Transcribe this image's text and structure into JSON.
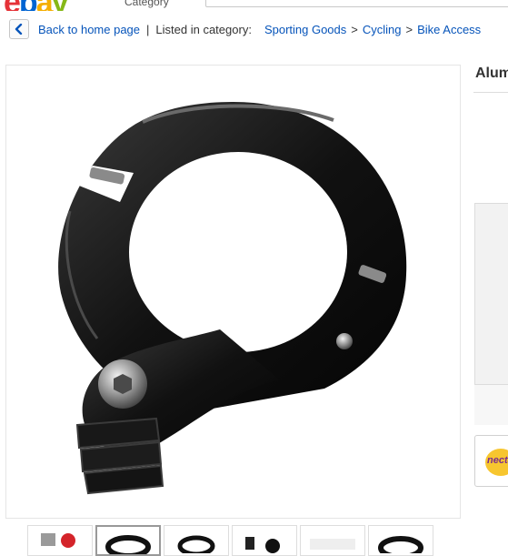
{
  "header": {
    "category_selector": "Category"
  },
  "breadcrumb": {
    "back_link": "Back to home page",
    "separator": "|",
    "listed_label": "Listed in category:",
    "crumbs": [
      "Sporting Goods",
      "Cycling",
      "Bike Access"
    ],
    "arrow": ">"
  },
  "listing": {
    "title": "Alum"
  },
  "sidebar": {
    "nectar_logo_text": "nectar"
  },
  "colors": {
    "link": "#0654ba",
    "buy_box": "#f2f2f2",
    "nectar_yellow": "#f7c62f",
    "nectar_purple": "#7b2c8e"
  },
  "icons": {
    "back": "chevron-left-icon"
  },
  "thumbnails": {
    "count": 6,
    "selected_index": 1
  }
}
